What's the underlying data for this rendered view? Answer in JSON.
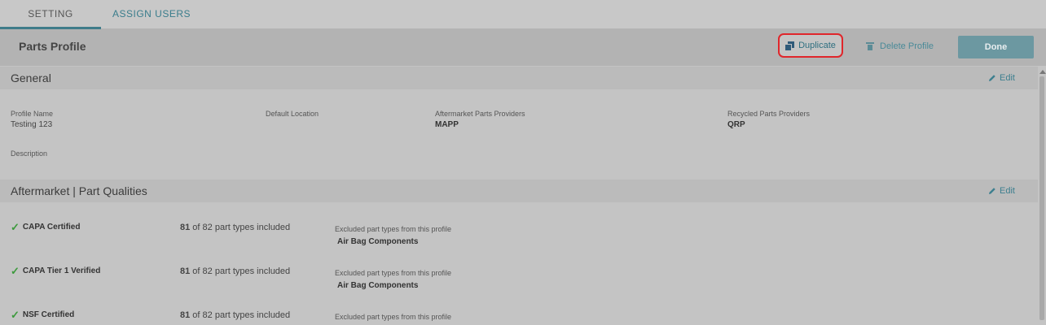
{
  "tabs": [
    {
      "label": "SETTING",
      "active": true
    },
    {
      "label": "ASSIGN USERS",
      "active": false
    }
  ],
  "header": {
    "title": "Parts Profile",
    "duplicate_label": "Duplicate",
    "delete_label": "Delete Profile",
    "done_label": "Done"
  },
  "general": {
    "title": "General",
    "edit_label": "Edit",
    "fields": {
      "profile_name_label": "Profile Name",
      "profile_name_value": "Testing 123",
      "default_location_label": "Default Location",
      "aftermarket_label": "Aftermarket Parts Providers",
      "aftermarket_value": "MAPP",
      "recycled_label": "Recycled Parts Providers",
      "recycled_value": "QRP",
      "description_label": "Description"
    }
  },
  "qualities": {
    "title": "Aftermarket | Part Qualities",
    "edit_label": "Edit",
    "rows": [
      {
        "name": "CAPA Certified",
        "included": "81",
        "count_suffix": " of 82 part types included",
        "excluded_label": "Excluded part types from this profile",
        "excluded_value": "Air Bag Components"
      },
      {
        "name": "CAPA Tier 1 Verified",
        "included": "81",
        "count_suffix": " of 82 part types included",
        "excluded_label": "Excluded part types from this profile",
        "excluded_value": "Air Bag Components"
      },
      {
        "name": "NSF Certified",
        "included": "81",
        "count_suffix": " of 82 part types included",
        "excluded_label": "Excluded part types from this profile",
        "excluded_value": ""
      }
    ]
  },
  "colors": {
    "accent": "#3a7d8c",
    "highlight": "#e0262b",
    "done_button": "#6c98a1",
    "check": "#3c9a3c"
  }
}
